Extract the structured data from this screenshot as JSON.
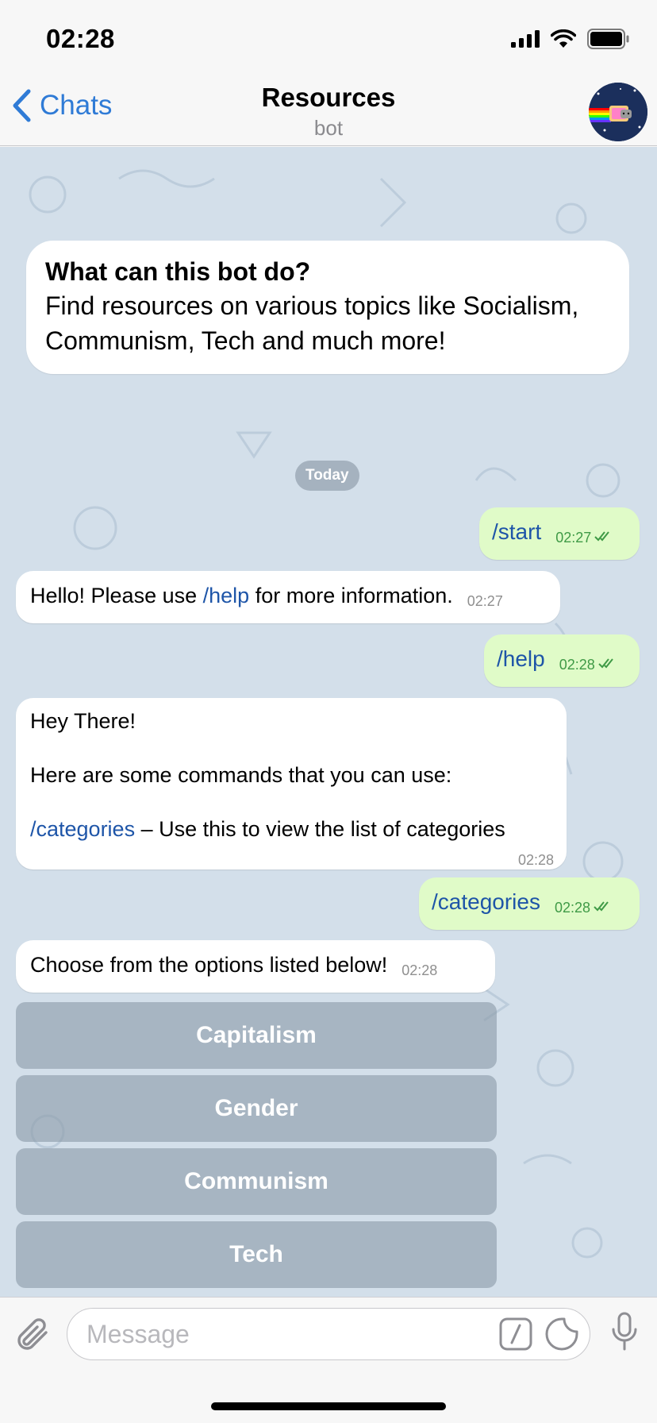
{
  "status_bar": {
    "time": "02:28"
  },
  "nav": {
    "back_label": "Chats",
    "title": "Resources",
    "subtitle": "bot"
  },
  "intro": {
    "title": "What can this bot do?",
    "text": "Find resources on various topics like Socialism, Communism, Tech and much more!"
  },
  "date_separator": "Today",
  "messages": [
    {
      "from": "user",
      "text": "/start",
      "time": "02:27"
    },
    {
      "from": "bot",
      "before": "Hello! Please use ",
      "command": "/help",
      "after": " for more information.",
      "time": "02:27"
    },
    {
      "from": "user",
      "text": "/help",
      "time": "02:28"
    },
    {
      "from": "bot",
      "line1": "Hey There!",
      "line2": "Here are some commands that you can use:",
      "command": "/categories",
      "after": " – Use this to view the list of categories",
      "time": "02:28"
    },
    {
      "from": "user",
      "text": "/categories",
      "time": "02:28"
    },
    {
      "from": "bot",
      "text": "Choose from the options listed below!",
      "time": "02:28"
    }
  ],
  "keyboard": [
    "Capitalism",
    "Gender",
    "Communism",
    "Tech"
  ],
  "input": {
    "placeholder": "Message"
  },
  "colors": {
    "accent": "#2f7bd6",
    "outgoing_bubble": "#e0fbc8",
    "chat_bg": "#d3dfea",
    "command_link": "#1e55a8"
  },
  "icons": [
    "signal-icon",
    "wifi-icon",
    "battery-icon",
    "back-chevron-icon",
    "attach-icon",
    "command-icon",
    "sticker-icon",
    "microphone-icon",
    "double-check-icon"
  ]
}
